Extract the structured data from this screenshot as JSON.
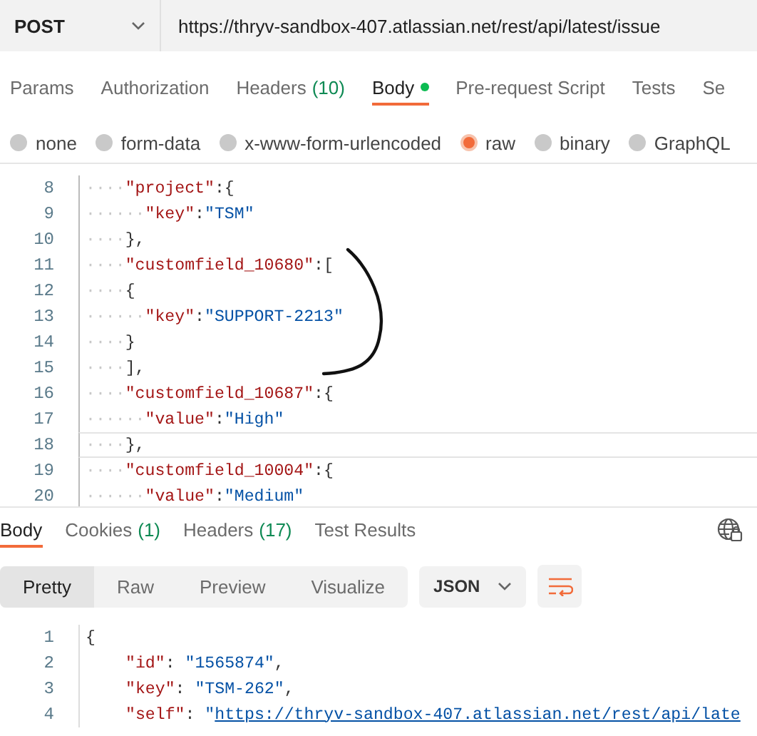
{
  "request": {
    "method": "POST",
    "url": "https://thryv-sandbox-407.atlassian.net/rest/api/latest/issue"
  },
  "request_tabs": [
    {
      "label": "Params",
      "selected": false
    },
    {
      "label": "Authorization",
      "selected": false
    },
    {
      "label": "Headers",
      "count": "(10)",
      "selected": false
    },
    {
      "label": "Body",
      "selected": true,
      "modified": true
    },
    {
      "label": "Pre-request Script",
      "selected": false
    },
    {
      "label": "Tests",
      "selected": false
    },
    {
      "label": "Se",
      "selected": false
    }
  ],
  "body_types": [
    {
      "label": "none",
      "selected": false
    },
    {
      "label": "form-data",
      "selected": false
    },
    {
      "label": "x-www-form-urlencoded",
      "selected": false
    },
    {
      "label": "raw",
      "selected": true
    },
    {
      "label": "binary",
      "selected": false
    },
    {
      "label": "GraphQL",
      "selected": false
    }
  ],
  "editor": {
    "lines": [
      {
        "number": "8",
        "tokens": [
          {
            "kind": "ws",
            "text": "····"
          },
          {
            "kind": "key",
            "text": "\"project\""
          },
          {
            "kind": "punct",
            "text": ":{"
          }
        ]
      },
      {
        "number": "9",
        "tokens": [
          {
            "kind": "ws",
            "text": "······"
          },
          {
            "kind": "key",
            "text": "\"key\""
          },
          {
            "kind": "punct",
            "text": ":"
          },
          {
            "kind": "string",
            "text": "\"TSM\""
          }
        ]
      },
      {
        "number": "10",
        "tokens": [
          {
            "kind": "ws",
            "text": "····"
          },
          {
            "kind": "punct",
            "text": "},"
          }
        ]
      },
      {
        "number": "11",
        "tokens": [
          {
            "kind": "ws",
            "text": "····"
          },
          {
            "kind": "key",
            "text": "\"customfield_10680\""
          },
          {
            "kind": "punct",
            "text": ":["
          }
        ]
      },
      {
        "number": "12",
        "tokens": [
          {
            "kind": "ws",
            "text": "····"
          },
          {
            "kind": "punct",
            "text": "{"
          }
        ]
      },
      {
        "number": "13",
        "tokens": [
          {
            "kind": "ws",
            "text": "······"
          },
          {
            "kind": "key",
            "text": "\"key\""
          },
          {
            "kind": "punct",
            "text": ":"
          },
          {
            "kind": "string",
            "text": "\"SUPPORT-2213\""
          }
        ]
      },
      {
        "number": "14",
        "tokens": [
          {
            "kind": "ws",
            "text": "····"
          },
          {
            "kind": "punct",
            "text": "}"
          }
        ]
      },
      {
        "number": "15",
        "tokens": [
          {
            "kind": "ws",
            "text": "····"
          },
          {
            "kind": "punct",
            "text": "],"
          }
        ]
      },
      {
        "number": "16",
        "tokens": [
          {
            "kind": "ws",
            "text": "····"
          },
          {
            "kind": "key",
            "text": "\"customfield_10687\""
          },
          {
            "kind": "punct",
            "text": ":{"
          }
        ]
      },
      {
        "number": "17",
        "tokens": [
          {
            "kind": "ws",
            "text": "······"
          },
          {
            "kind": "key",
            "text": "\"value\""
          },
          {
            "kind": "punct",
            "text": ":"
          },
          {
            "kind": "string",
            "text": "\"High\""
          }
        ]
      },
      {
        "number": "18",
        "current": true,
        "tokens": [
          {
            "kind": "ws",
            "text": "····"
          },
          {
            "kind": "punct",
            "text": "},"
          }
        ]
      },
      {
        "number": "19",
        "tokens": [
          {
            "kind": "ws",
            "text": "····"
          },
          {
            "kind": "key",
            "text": "\"customfield_10004\""
          },
          {
            "kind": "punct",
            "text": ":{"
          }
        ]
      },
      {
        "number": "20",
        "tokens": [
          {
            "kind": "ws",
            "text": "······"
          },
          {
            "kind": "key",
            "text": "\"value\""
          },
          {
            "kind": "punct",
            "text": ":"
          },
          {
            "kind": "string",
            "text": "\"Medium\""
          }
        ]
      }
    ]
  },
  "response": {
    "tabs": [
      {
        "label": "Body",
        "selected": true
      },
      {
        "label": "Cookies",
        "count": "(1)",
        "selected": false
      },
      {
        "label": "Headers",
        "count": "(17)",
        "selected": false
      },
      {
        "label": "Test Results",
        "selected": false
      }
    ],
    "views": [
      {
        "label": "Pretty",
        "selected": true
      },
      {
        "label": "Raw",
        "selected": false
      },
      {
        "label": "Preview",
        "selected": false
      },
      {
        "label": "Visualize",
        "selected": false
      }
    ],
    "format": "JSON",
    "lines": [
      {
        "number": "1",
        "tokens": [
          {
            "kind": "punct",
            "text": "{"
          }
        ],
        "children": [
          {
            "number": "2",
            "tokens": [
              {
                "kind": "key",
                "text": "\"id\""
              },
              {
                "kind": "punct",
                "text": ": "
              },
              {
                "kind": "string",
                "text": "\"1565874\""
              },
              {
                "kind": "punct",
                "text": ","
              }
            ]
          },
          {
            "number": "3",
            "tokens": [
              {
                "kind": "key",
                "text": "\"key\""
              },
              {
                "kind": "punct",
                "text": ": "
              },
              {
                "kind": "string",
                "text": "\"TSM-262\""
              },
              {
                "kind": "punct",
                "text": ","
              }
            ]
          },
          {
            "number": "4",
            "tokens": [
              {
                "kind": "key",
                "text": "\"self\""
              },
              {
                "kind": "punct",
                "text": ": "
              },
              {
                "kind": "string",
                "text": "\""
              },
              {
                "kind": "link",
                "text": "https://thryv-sandbox-407.atlassian.net/rest/api/late"
              }
            ]
          }
        ]
      }
    ]
  }
}
